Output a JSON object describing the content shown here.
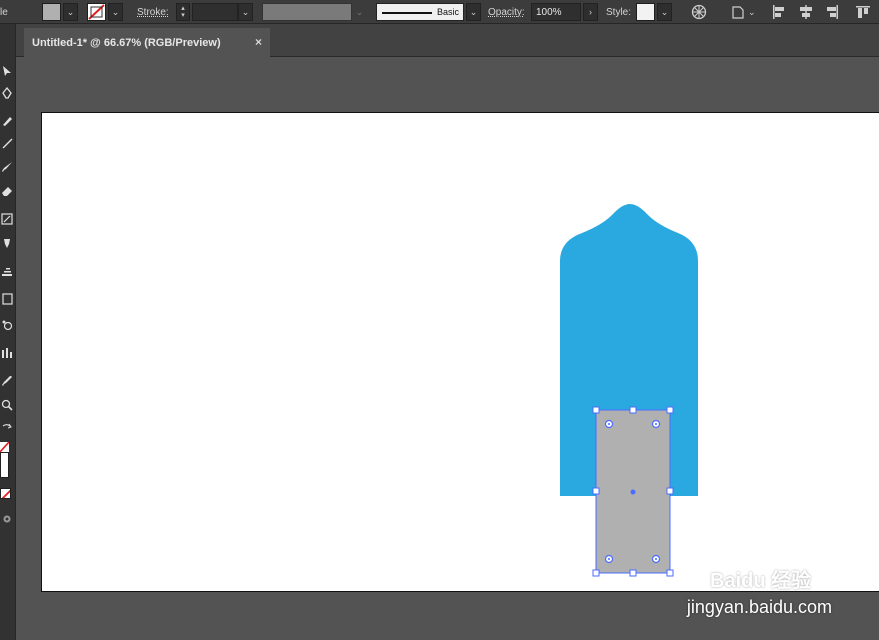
{
  "control_bar": {
    "left_clip_text": "le",
    "fill_color": "#b0b0b0",
    "stroke_label": "Stroke:",
    "stroke_value": "",
    "brush_label": "Basic",
    "opacity_label": "Opacity:",
    "opacity_value": "100%",
    "style_label": "Style:"
  },
  "document": {
    "tab_title": "Untitled-1* @ 66.67% (RGB/Preview)",
    "close_glyph": "×"
  },
  "canvas": {
    "background": "#ffffff",
    "shape_color": "#29a9e0",
    "selected_fill": "#b0b0b0",
    "selection_color": "#4a6cff"
  },
  "watermark": {
    "brand": "Baidu 经验",
    "url": "jingyan.baidu.com"
  }
}
